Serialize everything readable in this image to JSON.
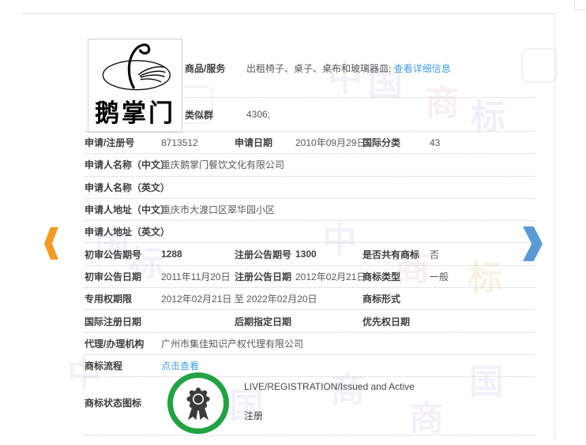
{
  "logo": {
    "text": "鹅掌门"
  },
  "top": {
    "goods_label": "商品/服务",
    "goods_value": "出租椅子、桌子、桌布和玻璃器皿; ",
    "goods_link": "查看详细信息",
    "similar_label": "类似群",
    "similar_value": "4306;"
  },
  "fields": {
    "reg_no": {
      "label": "申请/注册号",
      "value": "8713512"
    },
    "app_date": {
      "label": "申请日期",
      "value": "2010年09月29日"
    },
    "intl_class": {
      "label": "国际分类",
      "value": "43"
    },
    "applicant_cn": {
      "label": "申请人名称（中文）",
      "value": "重庆鹅掌门餐饮文化有限公司"
    },
    "applicant_en": {
      "label": "申请人名称（英文）",
      "value": ""
    },
    "address_cn": {
      "label": "申请人地址（中文）",
      "value": "重庆市大渡口区翠华园小区"
    },
    "address_en": {
      "label": "申请人地址（英文）",
      "value": ""
    },
    "first_pub_no": {
      "label": "初审公告期号",
      "value": "1288"
    },
    "reg_pub_no": {
      "label": "注册公告期号",
      "value": "1300"
    },
    "is_shared": {
      "label": "是否共有商标",
      "value": "否"
    },
    "first_pub_date": {
      "label": "初审公告日期",
      "value": "2011年11月20日"
    },
    "reg_pub_date": {
      "label": "注册公告日期",
      "value": "2012年02月21日"
    },
    "tm_type": {
      "label": "商标类型",
      "value": "一般"
    },
    "exclusive_period": {
      "label": "专用权期限",
      "value": "2012年02月21日 至 2022年02月20日"
    },
    "tm_form": {
      "label": "商标形式",
      "value": ""
    },
    "intl_reg_date": {
      "label": "国际注册日期",
      "value": ""
    },
    "later_desig_date": {
      "label": "后期指定日期",
      "value": ""
    },
    "priority_date": {
      "label": "优先权日期",
      "value": ""
    },
    "agent": {
      "label": "代理/办理机构",
      "value": "广州市集佳知识产权代理有限公司"
    },
    "tm_process": {
      "label": "商标流程",
      "link": "点击查看"
    }
  },
  "status": {
    "label": "商标状态图标",
    "line1": "LIVE/REGISTRATION/Issued and Active",
    "line2": "注册"
  },
  "watermarks": {
    "chars": [
      "中",
      "国",
      "商",
      "标"
    ]
  },
  "colors": {
    "link_blue": "#45a0e6",
    "nav_orange": "#F59A23",
    "nav_blue": "#5B9BD5",
    "status_green": "#21A343",
    "medal_gray": "#3c3c3c"
  }
}
